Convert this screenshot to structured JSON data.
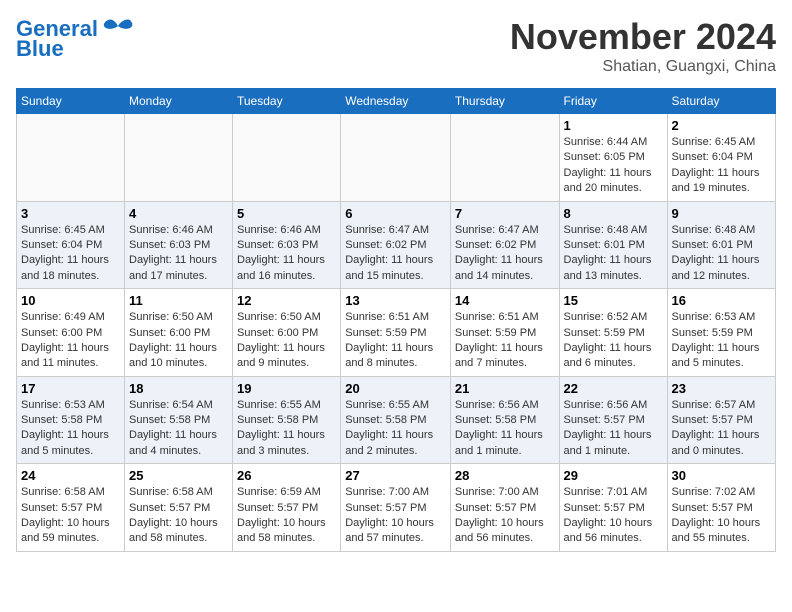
{
  "header": {
    "logo_line1": "General",
    "logo_line2": "Blue",
    "month_title": "November 2024",
    "location": "Shatian, Guangxi, China"
  },
  "weekdays": [
    "Sunday",
    "Monday",
    "Tuesday",
    "Wednesday",
    "Thursday",
    "Friday",
    "Saturday"
  ],
  "weeks": [
    [
      {
        "day": "",
        "info": ""
      },
      {
        "day": "",
        "info": ""
      },
      {
        "day": "",
        "info": ""
      },
      {
        "day": "",
        "info": ""
      },
      {
        "day": "",
        "info": ""
      },
      {
        "day": "1",
        "info": "Sunrise: 6:44 AM\nSunset: 6:05 PM\nDaylight: 11 hours\nand 20 minutes."
      },
      {
        "day": "2",
        "info": "Sunrise: 6:45 AM\nSunset: 6:04 PM\nDaylight: 11 hours\nand 19 minutes."
      }
    ],
    [
      {
        "day": "3",
        "info": "Sunrise: 6:45 AM\nSunset: 6:04 PM\nDaylight: 11 hours\nand 18 minutes."
      },
      {
        "day": "4",
        "info": "Sunrise: 6:46 AM\nSunset: 6:03 PM\nDaylight: 11 hours\nand 17 minutes."
      },
      {
        "day": "5",
        "info": "Sunrise: 6:46 AM\nSunset: 6:03 PM\nDaylight: 11 hours\nand 16 minutes."
      },
      {
        "day": "6",
        "info": "Sunrise: 6:47 AM\nSunset: 6:02 PM\nDaylight: 11 hours\nand 15 minutes."
      },
      {
        "day": "7",
        "info": "Sunrise: 6:47 AM\nSunset: 6:02 PM\nDaylight: 11 hours\nand 14 minutes."
      },
      {
        "day": "8",
        "info": "Sunrise: 6:48 AM\nSunset: 6:01 PM\nDaylight: 11 hours\nand 13 minutes."
      },
      {
        "day": "9",
        "info": "Sunrise: 6:48 AM\nSunset: 6:01 PM\nDaylight: 11 hours\nand 12 minutes."
      }
    ],
    [
      {
        "day": "10",
        "info": "Sunrise: 6:49 AM\nSunset: 6:00 PM\nDaylight: 11 hours\nand 11 minutes."
      },
      {
        "day": "11",
        "info": "Sunrise: 6:50 AM\nSunset: 6:00 PM\nDaylight: 11 hours\nand 10 minutes."
      },
      {
        "day": "12",
        "info": "Sunrise: 6:50 AM\nSunset: 6:00 PM\nDaylight: 11 hours\nand 9 minutes."
      },
      {
        "day": "13",
        "info": "Sunrise: 6:51 AM\nSunset: 5:59 PM\nDaylight: 11 hours\nand 8 minutes."
      },
      {
        "day": "14",
        "info": "Sunrise: 6:51 AM\nSunset: 5:59 PM\nDaylight: 11 hours\nand 7 minutes."
      },
      {
        "day": "15",
        "info": "Sunrise: 6:52 AM\nSunset: 5:59 PM\nDaylight: 11 hours\nand 6 minutes."
      },
      {
        "day": "16",
        "info": "Sunrise: 6:53 AM\nSunset: 5:59 PM\nDaylight: 11 hours\nand 5 minutes."
      }
    ],
    [
      {
        "day": "17",
        "info": "Sunrise: 6:53 AM\nSunset: 5:58 PM\nDaylight: 11 hours\nand 5 minutes."
      },
      {
        "day": "18",
        "info": "Sunrise: 6:54 AM\nSunset: 5:58 PM\nDaylight: 11 hours\nand 4 minutes."
      },
      {
        "day": "19",
        "info": "Sunrise: 6:55 AM\nSunset: 5:58 PM\nDaylight: 11 hours\nand 3 minutes."
      },
      {
        "day": "20",
        "info": "Sunrise: 6:55 AM\nSunset: 5:58 PM\nDaylight: 11 hours\nand 2 minutes."
      },
      {
        "day": "21",
        "info": "Sunrise: 6:56 AM\nSunset: 5:58 PM\nDaylight: 11 hours\nand 1 minute."
      },
      {
        "day": "22",
        "info": "Sunrise: 6:56 AM\nSunset: 5:57 PM\nDaylight: 11 hours\nand 1 minute."
      },
      {
        "day": "23",
        "info": "Sunrise: 6:57 AM\nSunset: 5:57 PM\nDaylight: 11 hours\nand 0 minutes."
      }
    ],
    [
      {
        "day": "24",
        "info": "Sunrise: 6:58 AM\nSunset: 5:57 PM\nDaylight: 10 hours\nand 59 minutes."
      },
      {
        "day": "25",
        "info": "Sunrise: 6:58 AM\nSunset: 5:57 PM\nDaylight: 10 hours\nand 58 minutes."
      },
      {
        "day": "26",
        "info": "Sunrise: 6:59 AM\nSunset: 5:57 PM\nDaylight: 10 hours\nand 58 minutes."
      },
      {
        "day": "27",
        "info": "Sunrise: 7:00 AM\nSunset: 5:57 PM\nDaylight: 10 hours\nand 57 minutes."
      },
      {
        "day": "28",
        "info": "Sunrise: 7:00 AM\nSunset: 5:57 PM\nDaylight: 10 hours\nand 56 minutes."
      },
      {
        "day": "29",
        "info": "Sunrise: 7:01 AM\nSunset: 5:57 PM\nDaylight: 10 hours\nand 56 minutes."
      },
      {
        "day": "30",
        "info": "Sunrise: 7:02 AM\nSunset: 5:57 PM\nDaylight: 10 hours\nand 55 minutes."
      }
    ]
  ]
}
